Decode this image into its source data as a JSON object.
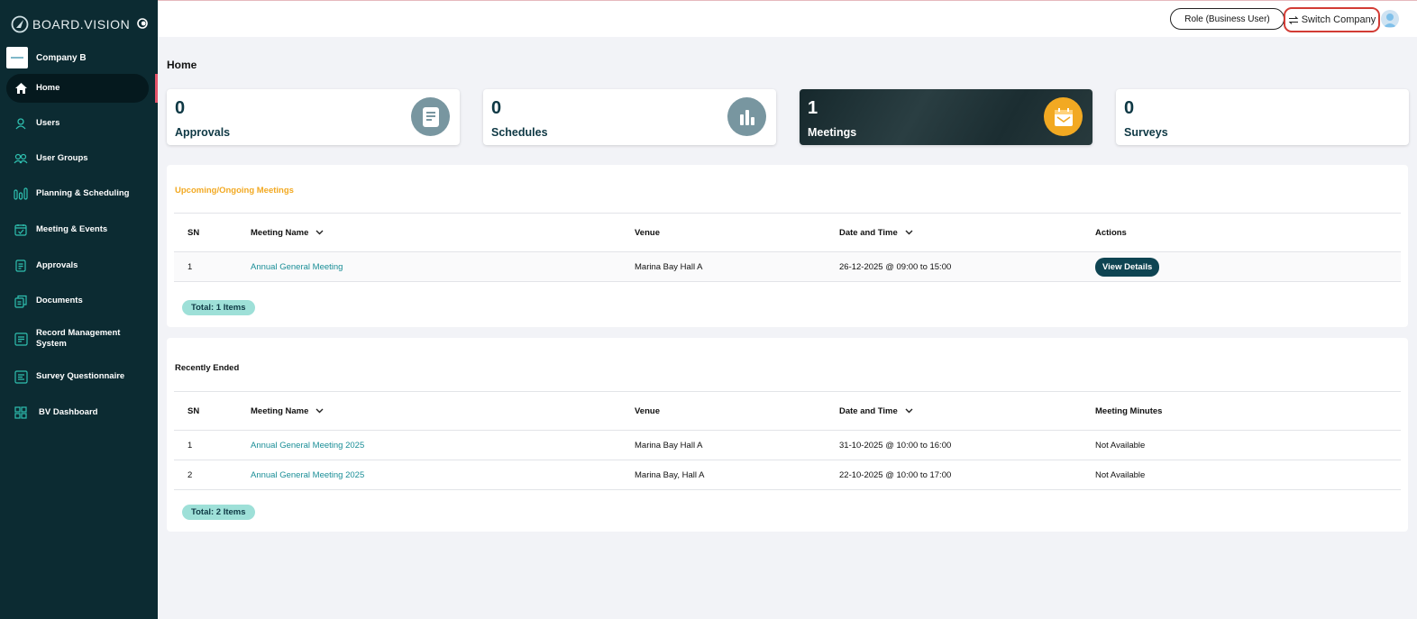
{
  "brand": {
    "name": "BOARD.VISION"
  },
  "company": {
    "name": "Company B"
  },
  "sidebar": {
    "items": [
      {
        "label": "Home",
        "icon": "home-icon",
        "active": true
      },
      {
        "label": "Users",
        "icon": "user-icon"
      },
      {
        "label": "User Groups",
        "icon": "user-group-icon"
      },
      {
        "label": "Planning & Scheduling",
        "icon": "planning-icon"
      },
      {
        "label": "Meeting & Events",
        "icon": "calendar-icon"
      },
      {
        "label": "Approvals",
        "icon": "approval-doc-icon"
      },
      {
        "label": "Documents",
        "icon": "documents-icon"
      },
      {
        "label": "Record Management System",
        "icon": "record-icon"
      },
      {
        "label": "Survey Questionnaire",
        "icon": "survey-icon"
      },
      {
        "label": "BV Dashboard",
        "icon": "dashboard-grid-icon"
      }
    ]
  },
  "topbar": {
    "role_label": "Role (Business User)",
    "switch_label": "Switch Company"
  },
  "page": {
    "title": "Home"
  },
  "cards": [
    {
      "count": "0",
      "label": "Approvals",
      "icon": "document-icon"
    },
    {
      "count": "0",
      "label": "Schedules",
      "icon": "bar-chart-icon"
    },
    {
      "count": "1",
      "label": "Meetings",
      "icon": "calendar-mail-icon"
    },
    {
      "count": "0",
      "label": "Surveys",
      "icon": ""
    }
  ],
  "upcoming": {
    "title": "Upcoming/Ongoing Meetings",
    "columns": [
      "SN",
      "Meeting Name",
      "Venue",
      "Date and Time",
      "Actions"
    ],
    "rows": [
      {
        "sn": "1",
        "name": "Annual General Meeting",
        "venue": "Marina Bay Hall A",
        "datetime": "26-12-2025 @ 09:00 to 15:00",
        "action": "View Details"
      }
    ],
    "total": "Total: 1 Items"
  },
  "recent": {
    "title": "Recently Ended",
    "columns": [
      "SN",
      "Meeting Name",
      "Venue",
      "Date and Time",
      "Meeting Minutes"
    ],
    "rows": [
      {
        "sn": "1",
        "name": "Annual General Meeting 2025",
        "venue": "Marina Bay Hall A",
        "datetime": "31-10-2025 @ 10:00 to 16:00",
        "minutes": "Not Available"
      },
      {
        "sn": "2",
        "name": "Annual General Meeting 2025",
        "venue": "Marina Bay, Hall A",
        "datetime": "22-10-2025 @ 10:00 to 17:00",
        "minutes": "Not Available"
      }
    ],
    "total": "Total: 2 Items"
  },
  "colors": {
    "sidebar_bg": "#0c2b32",
    "accent_teal": "#1a8e97",
    "upcoming_title": "#f2a922",
    "switch_highlight": "#d23c35"
  }
}
